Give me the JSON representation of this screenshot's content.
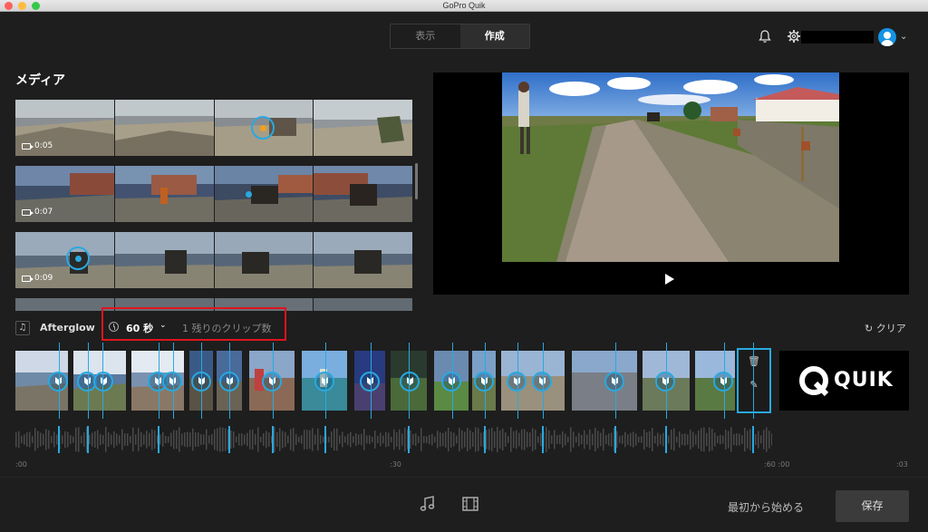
{
  "window": {
    "title": "GoPro Quik"
  },
  "header": {
    "tabs": [
      {
        "label": "表示",
        "active": false
      },
      {
        "label": "作成",
        "active": true
      }
    ]
  },
  "media": {
    "title": "メディア",
    "items": [
      {
        "duration": "0:05",
        "highlight_color": "#f0a020"
      },
      {
        "duration": "0:07",
        "highlight_color": "#29a9e0"
      },
      {
        "duration": "0:09",
        "highlight_color": "#29a9e0"
      }
    ]
  },
  "controls": {
    "song": "Afterglow",
    "duration": "60 秒",
    "remaining": "1 残りのクリップ数",
    "clear": "クリア"
  },
  "timeline": {
    "ticks": [
      ":00",
      ":30",
      ":60 :00",
      ":03"
    ],
    "logo_text": "QUIK"
  },
  "footer": {
    "restart": "最初から始める",
    "save": "保存"
  },
  "colors": {
    "accent": "#29a9e0",
    "annotation": "#e0141e",
    "background": "#1e1e1e"
  }
}
